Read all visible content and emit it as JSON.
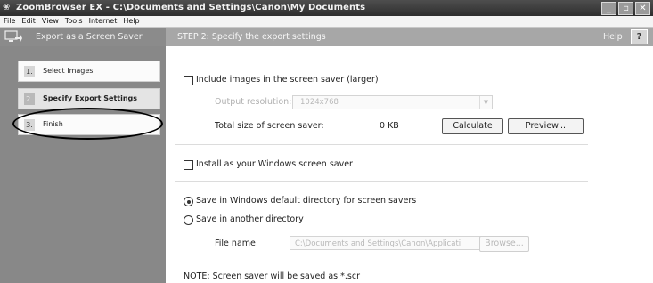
{
  "titlebar": {
    "title": "ZoomBrowser EX  -  C:\\Documents and Settings\\Canon\\My Documents",
    "buttons": [
      "_",
      "▫",
      "✕"
    ]
  },
  "menu": [
    "File",
    "Edit",
    "View",
    "Tools",
    "Internet",
    "Help"
  ],
  "header": {
    "export_title": "Export as a Screen Saver",
    "step_title": "STEP 2: Specify the export settings",
    "help_label": "Help",
    "help_button": "?"
  },
  "steps": [
    {
      "num": "1.",
      "label": "Select Images",
      "active": false
    },
    {
      "num": "2.",
      "label": "Specify Export Settings",
      "active": true
    },
    {
      "num": "3.",
      "label": "Finish",
      "active": false
    }
  ],
  "main": {
    "include_images_label": "Include images in the screen saver (larger)",
    "output_resolution_label": "Output resolution:",
    "output_resolution_value": "1024x768",
    "total_size_label": "Total size of screen saver:",
    "total_size_value": "0 KB",
    "calculate_button": "Calculate",
    "preview_button": "Preview...",
    "install_label": "Install as your Windows screen saver",
    "save_default_label": "Save in Windows default directory for screen savers",
    "save_other_label": "Save in another directory",
    "file_name_label": "File name:",
    "file_name_value": "C:\\Documents and Settings\\Canon\\Applicati",
    "browse_button": "Browse...",
    "note": "NOTE: Screen saver will be saved as *.scr"
  }
}
